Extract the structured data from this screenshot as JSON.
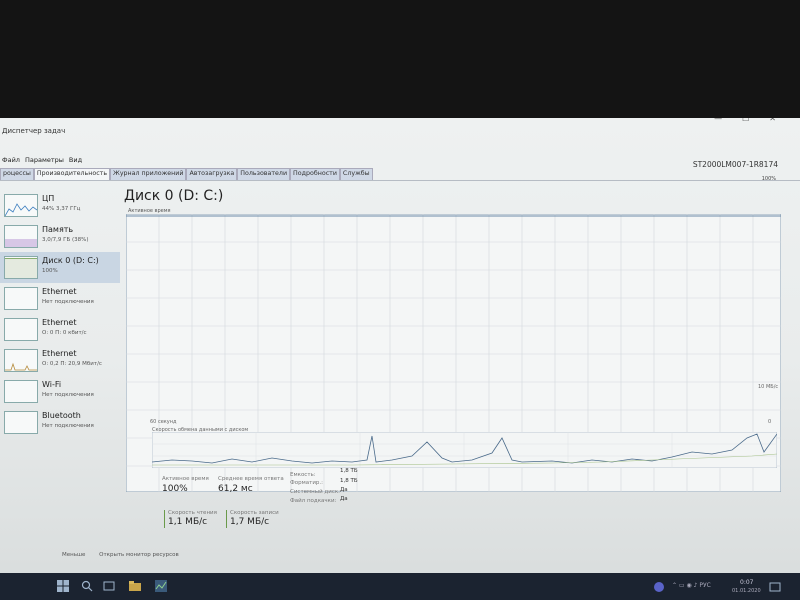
{
  "window": {
    "title": "Диспетчер задач",
    "model": "ST2000LM007-1R8174"
  },
  "menu": [
    "Файл",
    "Параметры",
    "Вид"
  ],
  "tabs": [
    "роцессы",
    "Производительность",
    "Журнал приложений",
    "Автозагрузка",
    "Пользователи",
    "Подробности",
    "Службы"
  ],
  "sidebar": [
    {
      "name": "ЦП",
      "sub": "44% 3,37 ГГц"
    },
    {
      "name": "Память",
      "sub": "3,0/7,9 ГБ (38%)"
    },
    {
      "name": "Диск 0 (D: C:)",
      "sub": "100%"
    },
    {
      "name": "Ethernet",
      "sub": "Нет подключения"
    },
    {
      "name": "Ethernet",
      "sub": "О: 0 П: 0 кбит/с"
    },
    {
      "name": "Ethernet",
      "sub": "О: 0,2 П: 20,9 Мбит/с"
    },
    {
      "name": "Wi-Fi",
      "sub": "Нет подключения"
    },
    {
      "name": "Bluetooth",
      "sub": "Нет подключения"
    }
  ],
  "main": {
    "title": "Диск 0 (D: C:)",
    "active_label": "Активное время",
    "pct100": "100%",
    "seconds_60": "60 секунд",
    "zero": "0",
    "transfer_label": "Скорость обмена данными с диском",
    "mbps_top": "10 МБ/с",
    "mbps_zero": "0"
  },
  "stats": {
    "active_time_label": "Активное время",
    "active_time_value": "100%",
    "response_label": "Среднее время ответа",
    "response_value": "61,2 мс",
    "read_label": "Скорость чтения",
    "read_value": "1,1 МБ/с",
    "write_label": "Скорость записи",
    "write_value": "1,7 МБ/с",
    "capacity_label": "Емкость:",
    "capacity_value": "1,8 ТБ",
    "formatted_label": "Форматир.:",
    "formatted_value": "1,8 ТБ",
    "system_label": "Системный диск:",
    "system_value": "Да",
    "pagefile_label": "Файл подкачки:",
    "pagefile_value": "Да"
  },
  "footer": {
    "less": "Меньше",
    "monitor": "Открыть монитор ресурсов"
  },
  "taskbar": {
    "time": "0:07",
    "date": "01.01.2020"
  },
  "colors": {
    "accent": "#3b7dbf",
    "graph_line": "#4a6a8a",
    "sel": "#c9d6e3"
  }
}
